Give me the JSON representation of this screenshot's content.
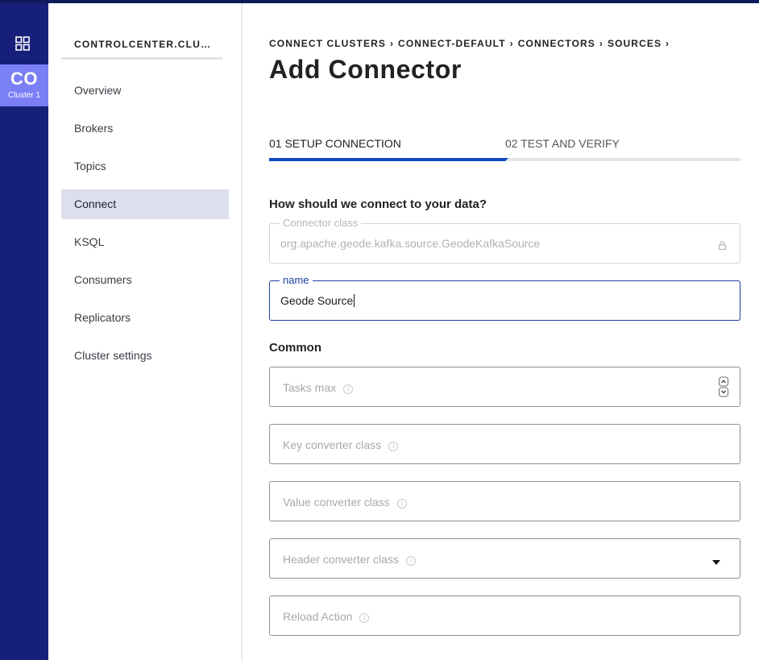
{
  "rail": {
    "cluster_abbr": "CO",
    "cluster_name": "Cluster 1"
  },
  "sidebar": {
    "cluster_title": "CONTROLCENTER.CLUST…",
    "items": [
      {
        "label": "Overview",
        "active": false
      },
      {
        "label": "Brokers",
        "active": false
      },
      {
        "label": "Topics",
        "active": false
      },
      {
        "label": "Connect",
        "active": true
      },
      {
        "label": "KSQL",
        "active": false
      },
      {
        "label": "Consumers",
        "active": false
      },
      {
        "label": "Replicators",
        "active": false
      },
      {
        "label": "Cluster settings",
        "active": false
      }
    ]
  },
  "breadcrumb": [
    "CONNECT CLUSTERS",
    "CONNECT-DEFAULT",
    "CONNECTORS",
    "SOURCES"
  ],
  "page_title": "Add Connector",
  "steps": [
    {
      "label": "01 SETUP CONNECTION",
      "active": true
    },
    {
      "label": "02 TEST AND VERIFY",
      "active": false
    }
  ],
  "step_progress_fraction": 0.5,
  "form": {
    "question": "How should we connect to your data?",
    "connector_class": {
      "legend": "Connector class",
      "value": "org.apache.geode.kafka.source.GeodeKafkaSource",
      "locked": true
    },
    "name": {
      "legend": "name",
      "value": "Geode Source"
    },
    "common_heading": "Common",
    "tasks_max": {
      "placeholder": "Tasks max"
    },
    "key_converter": {
      "placeholder": "Key converter class"
    },
    "value_converter": {
      "placeholder": "Value converter class"
    },
    "header_converter": {
      "placeholder": "Header converter class"
    },
    "reload_action": {
      "placeholder": "Reload Action"
    }
  },
  "icons": {
    "apps": "grid-icon",
    "lock": "lock-icon",
    "info": "info-icon",
    "stepper": "number-stepper-icon",
    "dropdown": "chevron-down-icon"
  },
  "colors": {
    "rail_bg": "#16207a",
    "cluster_tile": "#7b7ff5",
    "accent": "#1248c2",
    "active_nav_bg": "#dcdfec"
  }
}
